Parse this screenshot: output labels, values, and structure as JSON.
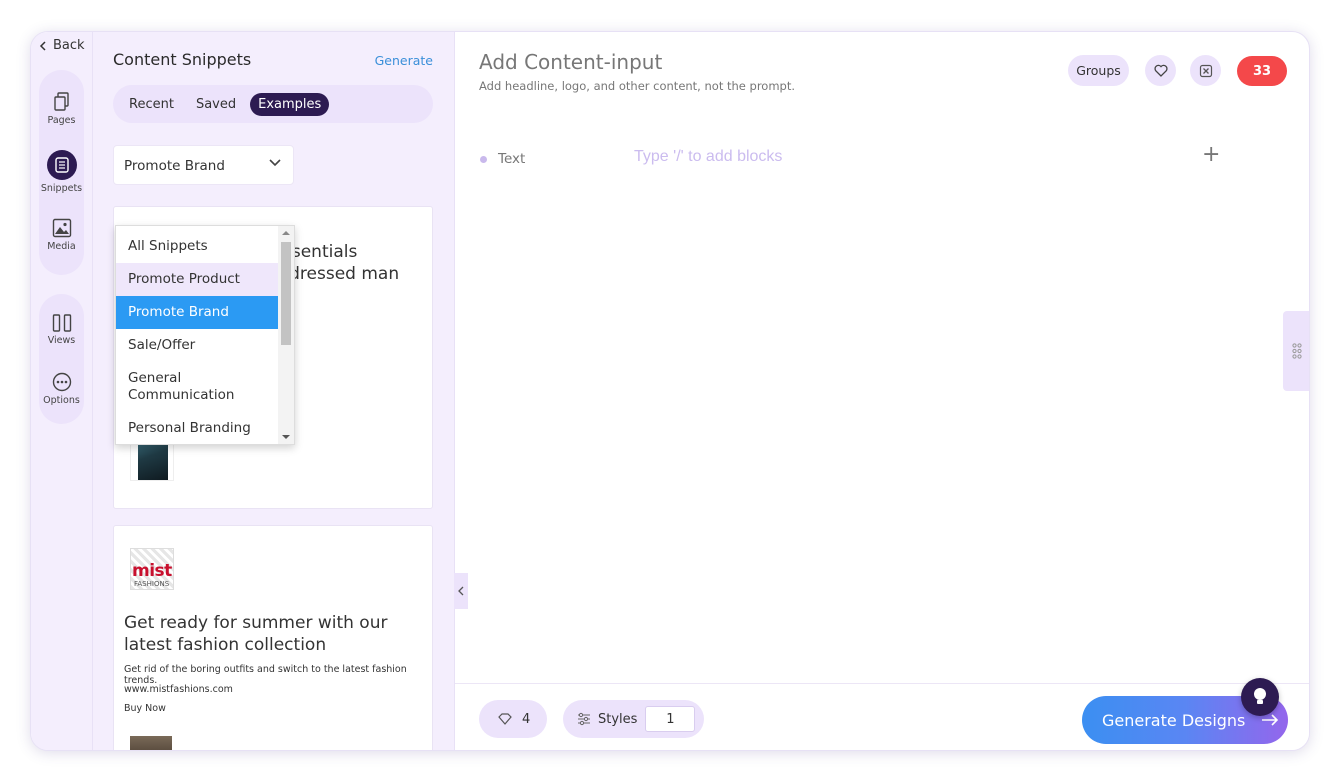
{
  "rail": {
    "back_label": "Back",
    "items": [
      {
        "label": "Pages",
        "icon": "pages-icon"
      },
      {
        "label": "Snippets",
        "icon": "snippets-icon"
      },
      {
        "label": "Media",
        "icon": "media-icon"
      },
      {
        "label": "Views",
        "icon": "views-icon"
      },
      {
        "label": "Options",
        "icon": "options-icon"
      }
    ]
  },
  "panel": {
    "title": "Content Snippets",
    "generate_label": "Generate",
    "tabs": [
      {
        "label": "Recent"
      },
      {
        "label": "Saved"
      },
      {
        "label": "Examples"
      }
    ],
    "select": {
      "value": "Promote Brand"
    },
    "dropdown": {
      "options": [
        "All Snippets",
        "Promote Product",
        "Promote Brand",
        "Sale/Offer",
        "General Communication",
        "Personal Branding"
      ]
    },
    "card1": {
      "text_line1": "ssentials",
      "text_line2": "-dressed man"
    },
    "card2": {
      "logo_text": "mist",
      "logo_sub": "FASHIONS",
      "headline": "Get ready for summer with our latest fashion collection",
      "body": "Get rid of the boring outfits and switch to the latest fashion trends.",
      "url": "www.mistfashions.com",
      "cta": "Buy Now"
    }
  },
  "main": {
    "title": "Add Content-input",
    "subtitle": "Add headline, logo, and other content, not the prompt.",
    "groups_label": "Groups",
    "count_badge": "33",
    "block": {
      "label": "Text",
      "placeholder": "Type '/' to add blocks",
      "add_symbol": "+"
    }
  },
  "footer": {
    "likes_count": "4",
    "styles_label": "Styles",
    "styles_value": "1",
    "generate_button": "Generate Designs"
  },
  "colors": {
    "accent_dark": "#2d1b52",
    "lavender": "#ece3fb",
    "badge_red": "#f4484a",
    "link_blue": "#3a8fd9",
    "selected_blue": "#2b9af3"
  }
}
